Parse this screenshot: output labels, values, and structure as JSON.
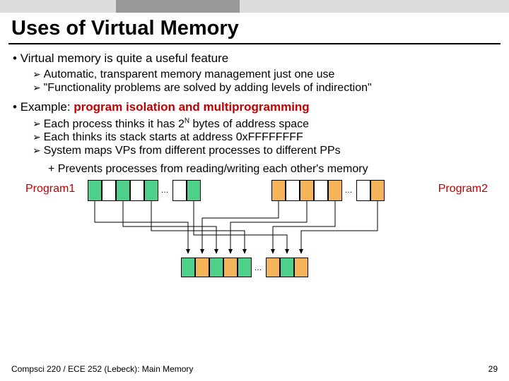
{
  "title": "Uses of Virtual Memory",
  "bullets": {
    "b1": "Virtual memory is quite a useful feature",
    "b1_1": "Automatic, transparent memory management just one use",
    "b1_2": "\"Functionality problems are solved by adding levels of indirection\"",
    "b2_pre": "Example: ",
    "b2_em": "program isolation and multiprogramming",
    "b2_1a": "Each process thinks it has 2",
    "b2_1sup": "N",
    "b2_1b": " bytes of address space",
    "b2_2": "Each thinks its stack starts at address 0xFFFFFFFF",
    "b2_3": "System maps VPs from different processes to different PPs",
    "b2_3_1": "Prevents processes from reading/writing each other's memory"
  },
  "diagram": {
    "left_label": "Program1",
    "right_label": "Program2",
    "dots": "…"
  },
  "footer": {
    "left": "Compsci 220 / ECE 252 (Lebeck): Main Memory",
    "right": "29"
  }
}
